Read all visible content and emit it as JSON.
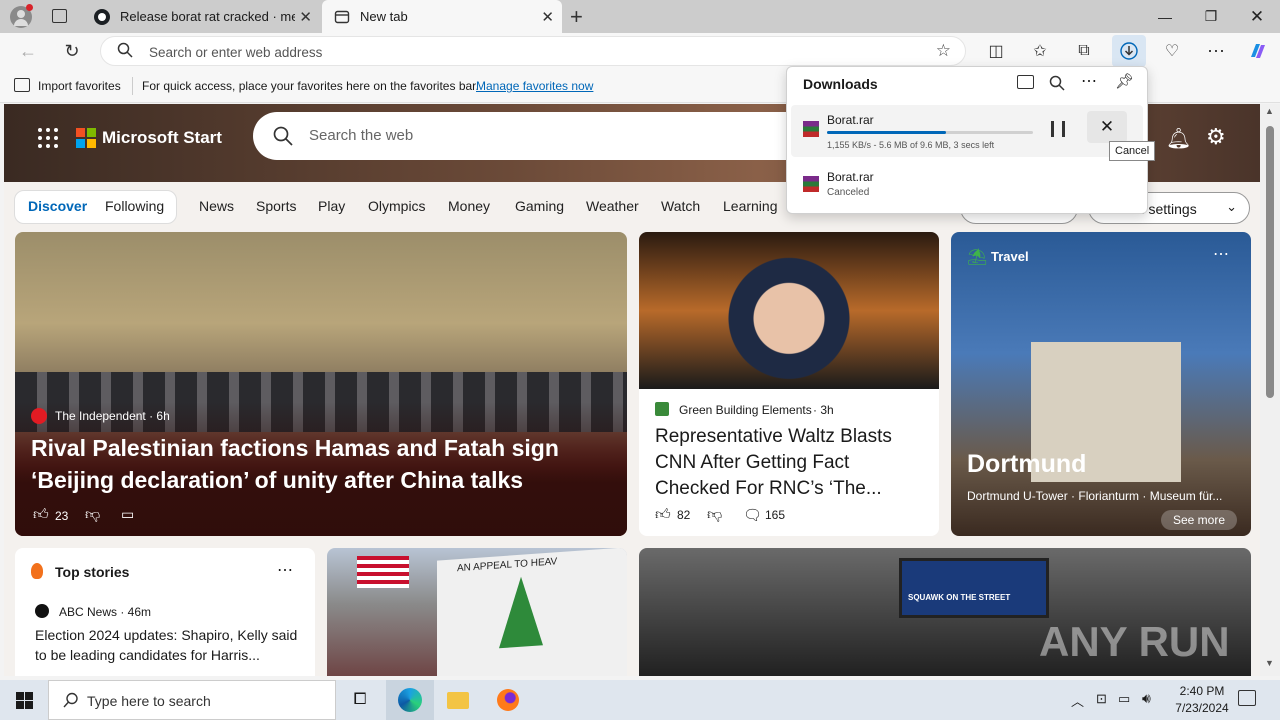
{
  "browser": {
    "tabs": [
      {
        "title": "Release borat rat cracked · mertc"
      },
      {
        "title": "New tab"
      }
    ],
    "address_placeholder": "Search or enter web address"
  },
  "favorites_bar": {
    "import_label": "Import favorites",
    "message": "For quick access, place your favorites here on the favorites bar.",
    "manage_link": "Manage favorites now"
  },
  "msn": {
    "brand": "Microsoft Start",
    "search_placeholder": "Search the web",
    "nav_pills": [
      "Discover",
      "Following"
    ],
    "nav_items": [
      "News",
      "Sports",
      "Play",
      "Olympics",
      "Money",
      "Gaming",
      "Weather",
      "Watch",
      "Learning"
    ],
    "settings_label": "ed settings"
  },
  "cards": {
    "main": {
      "source": "The Independent · 6h",
      "headline": "Rival Palestinian factions Hamas and Fatah sign ‘Beijing declaration’ of unity after China talks",
      "likes": "23"
    },
    "second": {
      "source": "Green Building Elements",
      "time": "· 3h",
      "headline": "Representative Waltz Blasts CNN After Getting Fact Checked For RNC’s ‘The...",
      "likes": "82",
      "comments": "165"
    },
    "travel": {
      "category": "Travel",
      "title": "Dortmund",
      "subtitle": "Dortmund U-Tower · Florianturm · Museum für...",
      "see_more": "See more"
    },
    "top_stories": {
      "header": "Top stories",
      "source": "ABC News · 46m",
      "headline": "Election 2024 updates: Shapiro, Kelly said to be leading candidates for Harris..."
    },
    "flag_banner_text": "AN APPEAL TO HEAV",
    "tv_banner_text": "SQUAWK ON THE STREET"
  },
  "downloads": {
    "title": "Downloads",
    "items": [
      {
        "name": "Borat.rar",
        "status": "1,155 KB/s - 5.6 MB of 9.6 MB, 3 secs left",
        "progress": 0.58
      },
      {
        "name": "Borat.rar",
        "status": "Canceled"
      }
    ],
    "cancel_tooltip": "Cancel"
  },
  "taskbar": {
    "search_placeholder": "Type here to search",
    "time": "2:40 PM",
    "date": "7/23/2024"
  },
  "watermark": "ANY RUN",
  "colors": {
    "accent": "#0067b8",
    "download_bar": "#0067b8",
    "taskbar_bg": "#dfe6ee"
  }
}
